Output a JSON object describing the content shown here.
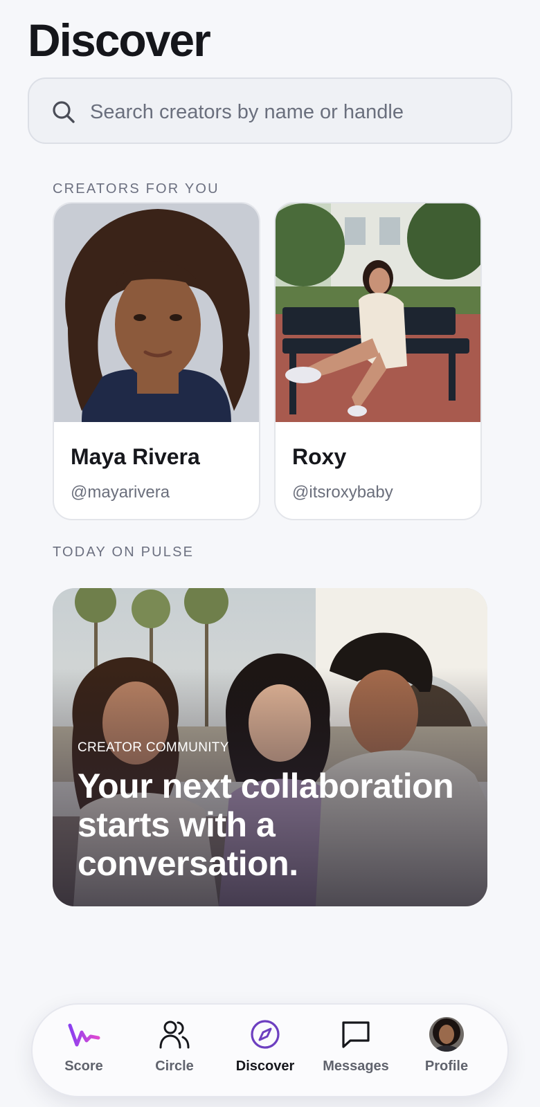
{
  "header": {
    "title": "Discover"
  },
  "search": {
    "placeholder": "Search creators by name or handle",
    "icon": "search-icon"
  },
  "creators_section": {
    "label": "CREATORS FOR YOU",
    "cards": [
      {
        "name": "Maya Rivera",
        "handle": "@mayarivera"
      },
      {
        "name": "Roxy",
        "handle": "@itsroxybaby"
      }
    ]
  },
  "today_section": {
    "label": "TODAY ON PULSE",
    "feature": {
      "kicker": "CREATOR COMMUNITY",
      "headline": "Your next collaboration starts with a conversation."
    }
  },
  "bottom_nav": {
    "items": [
      {
        "label": "Score",
        "icon": "score-pulse-icon"
      },
      {
        "label": "Circle",
        "icon": "people-icon"
      },
      {
        "label": "Discover",
        "icon": "compass-icon",
        "active": true
      },
      {
        "label": "Messages",
        "icon": "chat-bubble-icon"
      },
      {
        "label": "Profile",
        "icon": "avatar"
      }
    ]
  },
  "colors": {
    "accent": "#6d3fc0",
    "score_gradient_start": "#8a3ff0",
    "score_gradient_end": "#e04ad0",
    "background": "#f6f7fa"
  }
}
